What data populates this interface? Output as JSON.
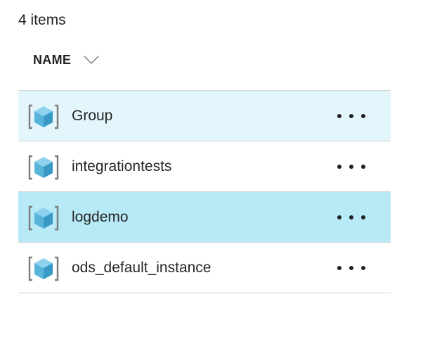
{
  "header": {
    "item_count": "4 items",
    "column_name": "NAME",
    "sort_icon": "chevron-down-icon"
  },
  "rows": [
    {
      "name": "Group",
      "state": "hover",
      "icon": "resource-group-cube-icon",
      "more_icon": "ellipsis-icon"
    },
    {
      "name": "integrationtests",
      "state": "normal",
      "icon": "resource-group-cube-icon",
      "more_icon": "ellipsis-icon"
    },
    {
      "name": "logdemo",
      "state": "selected",
      "icon": "resource-group-cube-icon",
      "more_icon": "ellipsis-icon"
    },
    {
      "name": "ods_default_instance",
      "state": "normal",
      "icon": "resource-group-cube-icon",
      "more_icon": "ellipsis-icon"
    }
  ],
  "colors": {
    "hover_bg": "#e3f6fc",
    "selected_bg": "#b7e9f7",
    "divider": "#d2d2d2",
    "cube_light": "#8fd2ef",
    "cube_mid": "#59b4d9",
    "cube_dark": "#3999c6",
    "bracket": "#7a7a7a"
  }
}
